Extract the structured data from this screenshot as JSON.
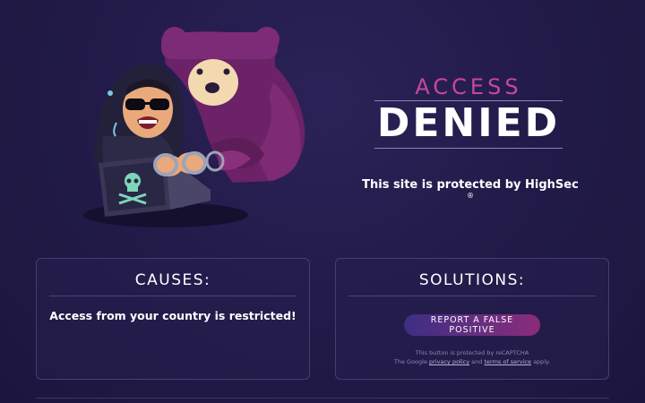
{
  "colors": {
    "background": "#221b4a",
    "accent_pink": "#c8479e",
    "button_start": "#3c2f85",
    "button_end": "#8b2c7a"
  },
  "hero": {
    "title_top": "ACCESS",
    "title_main": "DENIED",
    "protected_text": "This site is protected by HighSec",
    "registered_mark": "®",
    "icons": [
      "hacker-icon",
      "bear-icon",
      "laptop-skull-icon",
      "handcuffs-icon"
    ]
  },
  "causes": {
    "title": "CAUSES:",
    "text": "Access from your country is restricted!"
  },
  "solutions": {
    "title": "SOLUTIONS:",
    "button_label": "REPORT A FALSE POSITIVE",
    "recaptcha_line1": "This button is protected by reCAPTCHA",
    "recaptcha_prefix": "The Google",
    "privacy_link": "privacy policy",
    "and_text": "and",
    "terms_link": "terms of service",
    "apply_text": "apply."
  }
}
